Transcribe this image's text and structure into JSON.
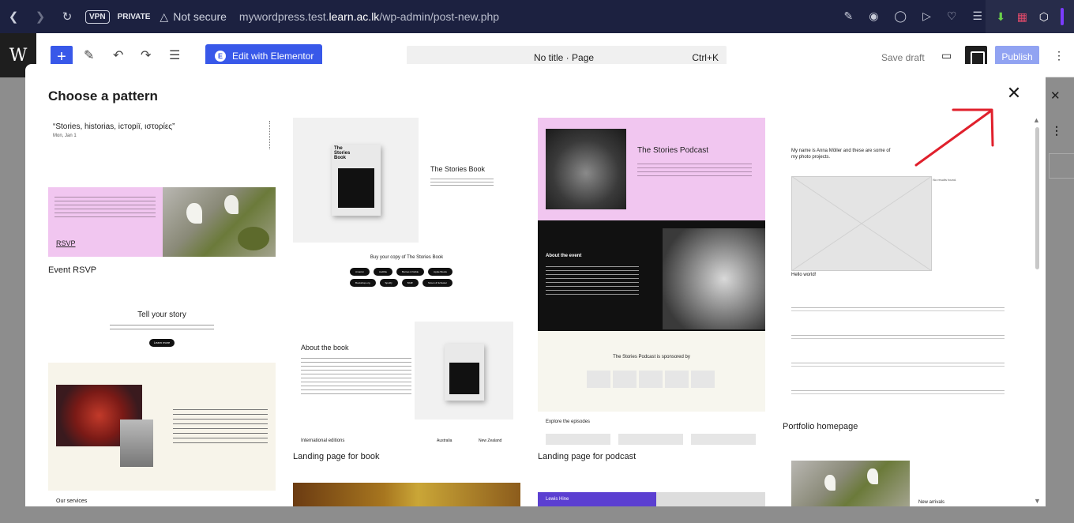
{
  "browser": {
    "vpn_label": "VPN",
    "private_label": "PRIVATE",
    "not_secure": "Not secure",
    "url_prefix": "mywordpress.test.",
    "url_domain": "learn.ac.lk",
    "url_path": "/wp-admin/post-new.php"
  },
  "editor": {
    "edit_with_elementor": "Edit with Elementor",
    "elementor_badge": "E",
    "doc_title": "No title · Page",
    "shortcut": "Ctrl+K",
    "save_draft": "Save draft",
    "publish": "Publish"
  },
  "modal": {
    "title": "Choose a pattern",
    "patterns": {
      "event_rsvp": {
        "label": "Event RSVP",
        "quote": "“Stories, historias, історії, ιστορίες”",
        "date": "Mon, Jan 1",
        "rsvp": "RSVP"
      },
      "book": {
        "label": "Landing page for book",
        "book_cover": "The Stories Book",
        "title": "The Stories Book",
        "buy": "Buy your copy of The Stories Book",
        "stores": [
          "Amazon",
          "Audible",
          "Barnes & Noble",
          "Apple Books",
          "Bookshop.org",
          "Spotify",
          "BAM!",
          "Simon & Schuster"
        ],
        "about": "About the book",
        "intl": "International editions",
        "australia": "Australia",
        "nz": "New Zealand"
      },
      "podcast": {
        "label": "Landing page for podcast",
        "title": "The Stories Podcast",
        "about_event": "About the event",
        "sponsored": "The Stories Podcast is sponsored by",
        "explore": "Explore the episodes"
      },
      "portfolio": {
        "label": "Portfolio homepage",
        "intro": "My name is Anna Möller and these are some of my photo projects.",
        "hello": "Hello world!",
        "no_results": "No results found.",
        "new_arrivals": "New arrivals"
      },
      "tell_story": {
        "title": "Tell your story",
        "button": "Learn more",
        "services": "Our services"
      },
      "lewis": {
        "name": "Lewis Hine"
      }
    }
  },
  "colors": {
    "accent": "#3858e9",
    "pink": "#f1c6f0",
    "browser_bar": "#1c2140",
    "annotation_arrow": "#e0202c"
  }
}
